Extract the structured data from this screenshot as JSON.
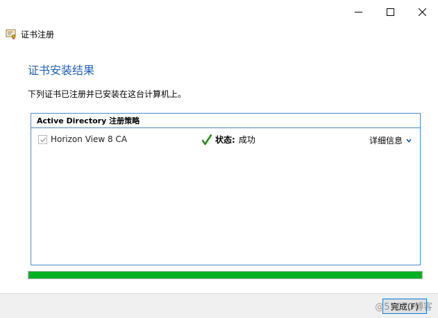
{
  "window": {
    "title": "证书注册",
    "buttons": {
      "minimize": "minimize-icon",
      "maximize": "maximize-icon",
      "close": "close-icon"
    }
  },
  "page": {
    "heading": "证书安装结果",
    "description": "下列证书已注册并已安装在这台计算机上。"
  },
  "results": {
    "group_title": "Active Directory 注册策略",
    "items": [
      {
        "name": "Horizon View 8 CA",
        "checked": true,
        "status_label": "状态:",
        "status_value": "成功",
        "details_label": "详细信息"
      }
    ]
  },
  "progress": {
    "value": 1.0,
    "color": "#06b025"
  },
  "footer": {
    "finish_label": "完成(F)"
  },
  "watermark": "@51CTO博客",
  "colors": {
    "accent": "#2062b0",
    "border": "#4a8ac4",
    "success": "#2e8b1e"
  }
}
